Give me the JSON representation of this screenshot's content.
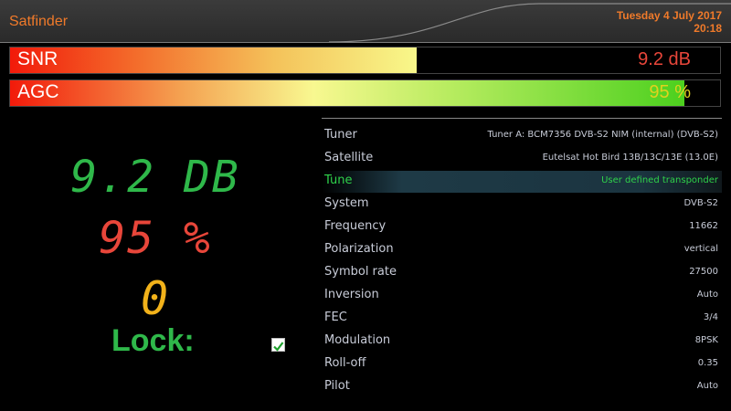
{
  "header": {
    "title": "Satfinder",
    "date": "Tuesday  4 July 2017",
    "time": "20:18"
  },
  "bars": {
    "snr": {
      "label": "SNR",
      "value": "9.2 dB",
      "fill_fraction": 0.573
    },
    "agc": {
      "label": "AGC",
      "value": "95 %",
      "fill_fraction": 0.95
    }
  },
  "readouts": {
    "snr": "9.2 DB",
    "agc": "95 %",
    "ber": "0",
    "lock_label": "Lock:",
    "locked": true
  },
  "details": [
    {
      "label": "Tuner",
      "value": "Tuner A: BCM7356 DVB-S2 NIM (internal) (DVB-S2)",
      "highlight": false
    },
    {
      "label": "Satellite",
      "value": "Eutelsat Hot Bird 13B/13C/13E (13.0E)",
      "highlight": false
    },
    {
      "label": "Tune",
      "value": "User defined transponder",
      "highlight": true
    },
    {
      "label": "System",
      "value": "DVB-S2",
      "highlight": false
    },
    {
      "label": "Frequency",
      "value": "11662",
      "highlight": false
    },
    {
      "label": "Polarization",
      "value": "vertical",
      "highlight": false
    },
    {
      "label": "Symbol rate",
      "value": "27500",
      "highlight": false
    },
    {
      "label": "Inversion",
      "value": "Auto",
      "highlight": false
    },
    {
      "label": "FEC",
      "value": "3/4",
      "highlight": false
    },
    {
      "label": "Modulation",
      "value": "8PSK",
      "highlight": false
    },
    {
      "label": "Roll-off",
      "value": "0.35",
      "highlight": false
    },
    {
      "label": "Pilot",
      "value": "Auto",
      "highlight": false
    }
  ],
  "colors": {
    "accent": "#f07a2a",
    "snr_text": "#e8463a",
    "agc_text": "#e0d21e",
    "big_snr": "#2fb84a",
    "big_agc": "#e8463a",
    "big_ber": "#f2b21a",
    "lock": "#2fb84a"
  }
}
